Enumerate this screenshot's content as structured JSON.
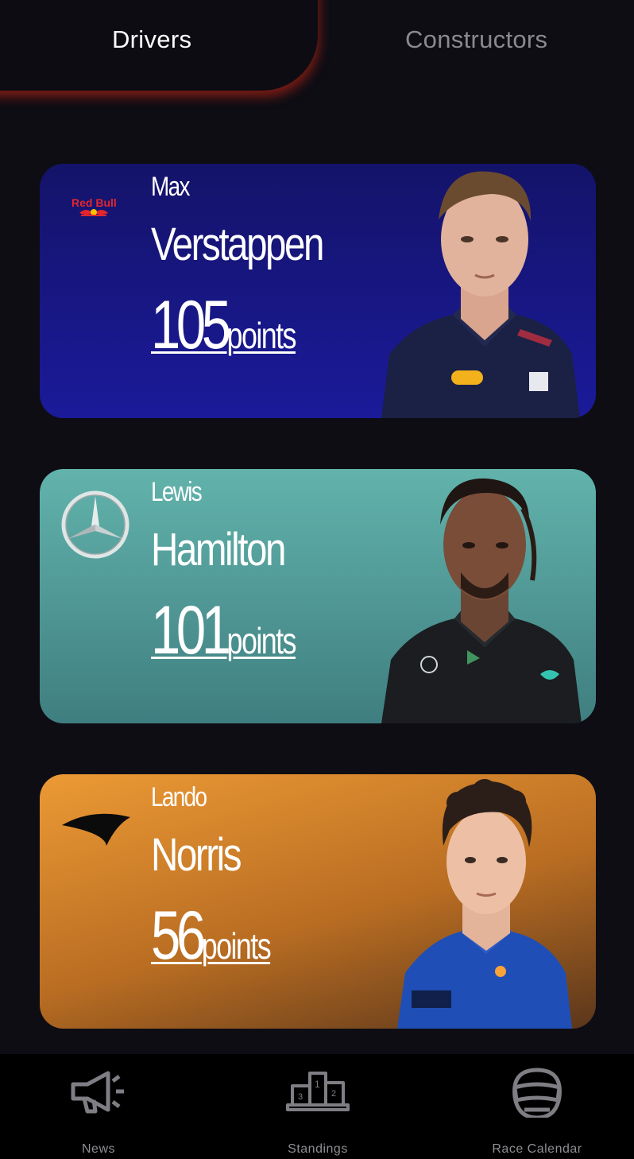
{
  "tabs": {
    "active_label": "Drivers",
    "inactive_label": "Constructors"
  },
  "drivers": [
    {
      "first_name": "Max",
      "last_name": "Verstappen",
      "points": "105",
      "points_unit": "points",
      "team": "Red Bull",
      "logo_text": "Red Bull",
      "card_color": "#1b1a9a"
    },
    {
      "first_name": "Lewis",
      "last_name": "Hamilton",
      "points": "101",
      "points_unit": "points",
      "team": "Mercedes",
      "card_color": "#4f9f9a"
    },
    {
      "first_name": "Lando",
      "last_name": "Norris",
      "points": "56",
      "points_unit": "points",
      "team": "McLaren",
      "card_color": "#d98a2e"
    }
  ],
  "nav": {
    "items": [
      {
        "label": "News",
        "icon": "megaphone-icon"
      },
      {
        "label": "Standings",
        "icon": "podium-icon"
      },
      {
        "label": "Race Calendar",
        "icon": "helmet-icon"
      }
    ]
  },
  "colors": {
    "background": "#0e0d14",
    "tab_glow": "#d22814",
    "inactive_text": "#8a898e",
    "nav_label": "#8e8e93"
  }
}
